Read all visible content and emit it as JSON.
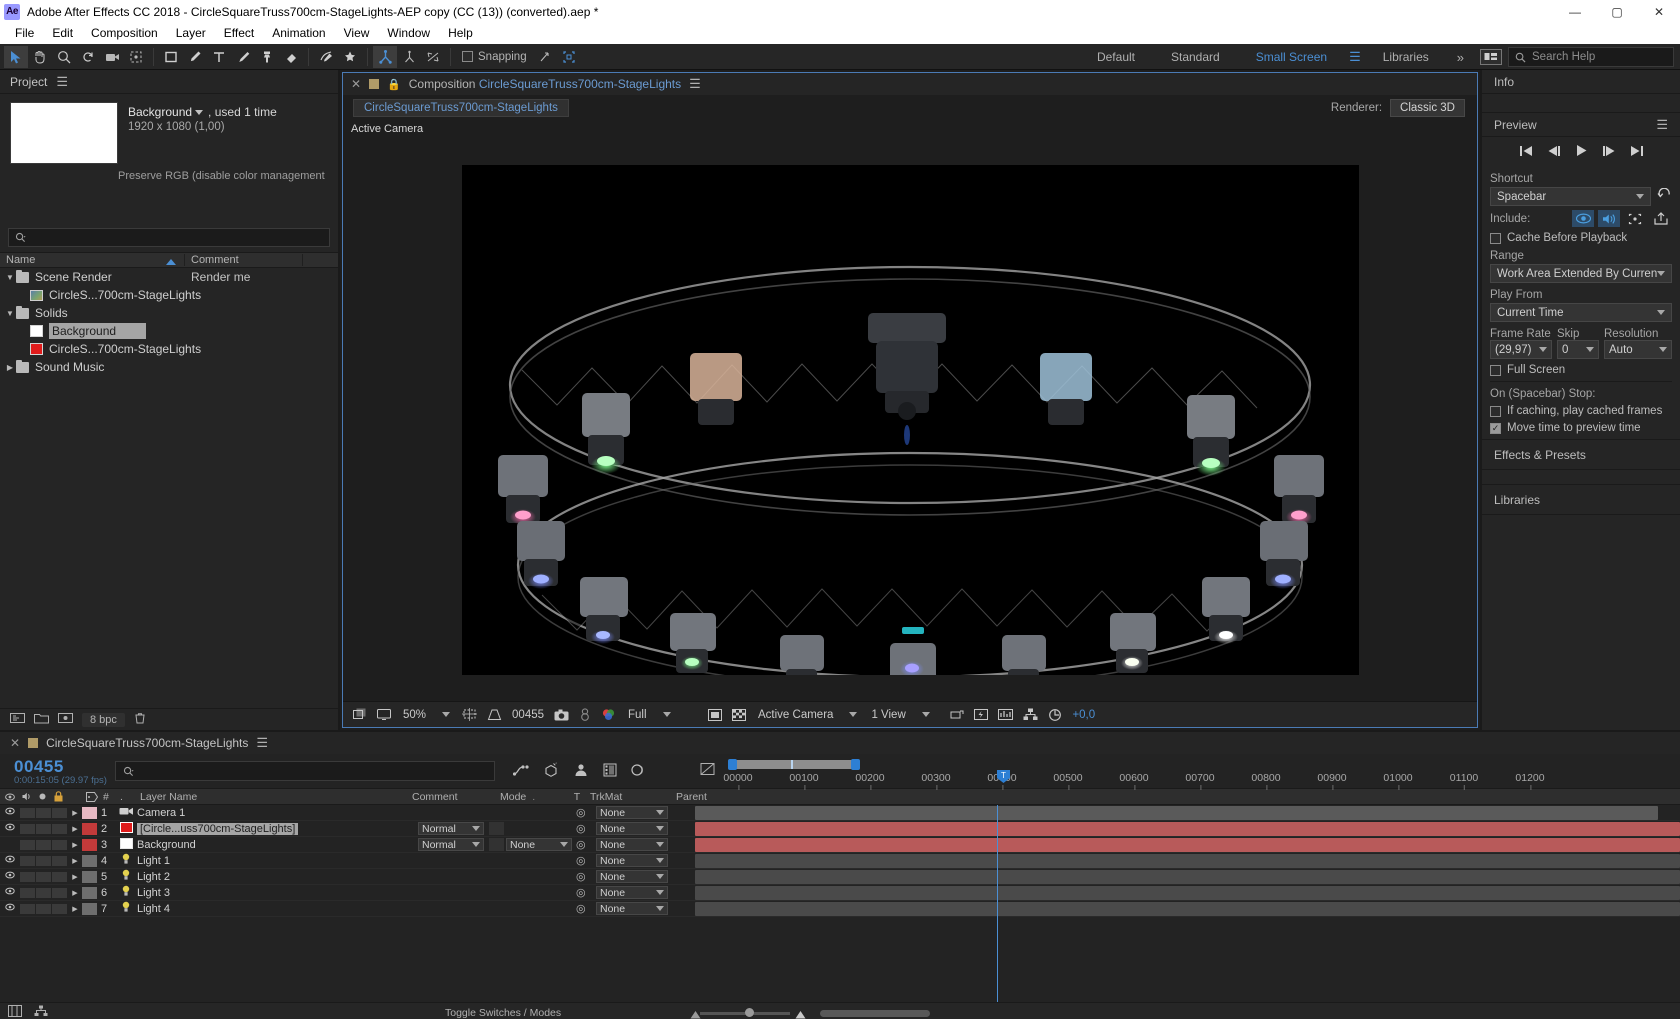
{
  "window": {
    "title": "Adobe After Effects CC 2018 - CircleSquareTruss700cm-StageLights-AEP copy (CC (13)) (converted).aep *",
    "logo": "Ae",
    "minimize": "—",
    "maximize": "▢",
    "close": "✕"
  },
  "menubar": [
    "File",
    "Edit",
    "Composition",
    "Layer",
    "Effect",
    "Animation",
    "View",
    "Window",
    "Help"
  ],
  "toolbar": {
    "snapping_label": "Snapping",
    "workspaces": [
      "Default",
      "Standard",
      "Small Screen"
    ],
    "selected_workspace": "Small Screen",
    "libraries_label": "Libraries",
    "chevrons": "»",
    "search_help_placeholder": "Search Help"
  },
  "project": {
    "tab_label": "Project",
    "item_name": "Background",
    "usage": ", used 1 time",
    "dimensions": "1920 x 1080 (1,00)",
    "color_note": "Preserve RGB (disable color management c...",
    "columns": [
      "Name",
      "Comment"
    ],
    "rows": [
      {
        "name": "Scene Render",
        "comment": "Render me",
        "type": "folder",
        "expanded": true,
        "indent": 0
      },
      {
        "name": "CircleS...700cm-StageLights",
        "comment": "",
        "type": "comp",
        "indent": 1
      },
      {
        "name": "Solids",
        "comment": "",
        "type": "folder",
        "expanded": true,
        "indent": 0
      },
      {
        "name": "Background",
        "comment": "",
        "type": "solid-white",
        "indent": 1,
        "selected": true
      },
      {
        "name": "CircleS...700cm-StageLights",
        "comment": "",
        "type": "solid-red",
        "indent": 1
      },
      {
        "name": "Sound Music",
        "comment": "",
        "type": "folder",
        "expanded": false,
        "indent": 0
      }
    ],
    "bpc_label": "8 bpc"
  },
  "composition": {
    "tab_prefix": "Composition",
    "tab_name": "CircleSquareTruss700cm-StageLights",
    "chip_label": "CircleSquareTruss700cm-StageLights",
    "renderer_label": "Renderer:",
    "renderer_value": "Classic 3D",
    "active_camera_label": "Active Camera",
    "bottom_bar": {
      "zoom": "50%",
      "timecode": "00455",
      "resolution": "Full",
      "camera_view": "Active Camera",
      "view_layout": "1 View",
      "exposure": "+0,0"
    }
  },
  "right_panel": {
    "info_label": "Info",
    "preview_label": "Preview",
    "shortcut_label": "Shortcut",
    "shortcut_value": "Spacebar",
    "include_label": "Include:",
    "cache_before_playback": "Cache Before Playback",
    "range_label": "Range",
    "range_value": "Work Area Extended By Current...",
    "play_from_label": "Play From",
    "play_from_value": "Current Time",
    "frame_rate_label": "Frame Rate",
    "frame_rate_value": "(29,97)",
    "skip_label": "Skip",
    "skip_value": "0",
    "resolution_label": "Resolution",
    "resolution_value": "Auto",
    "full_screen": "Full Screen",
    "on_stop_label": "On (Spacebar) Stop:",
    "if_caching": "If caching, play cached frames",
    "move_time": "Move time to preview time",
    "effects_presets_label": "Effects & Presets",
    "libraries_label": "Libraries"
  },
  "timeline": {
    "tab_name": "CircleSquareTruss700cm-StageLights",
    "current_frame": "00455",
    "current_time": "0:00:15:05 (29.97 fps)",
    "columns": [
      "Layer Name",
      "Comment",
      "Mode",
      "T",
      "TrkMat",
      "Parent"
    ],
    "ruler_labels": [
      "00000",
      "00100",
      "00200",
      "00300",
      "00400",
      "00500",
      "00600",
      "00700",
      "00800",
      "00900",
      "01000",
      "01100",
      "01200"
    ],
    "cti_label": "T",
    "toggle_switches_label": "Toggle Switches / Modes",
    "layers": [
      {
        "num": "1",
        "name": "Camera 1",
        "icon": "camera-icon",
        "mode": "",
        "trkmat": "",
        "parent": "None",
        "color": "#e7b9c3",
        "visible": true,
        "highlighted": false,
        "bar_color": "#5a5a5a"
      },
      {
        "num": "2",
        "name": "[Circle...uss700cm-StageLights]",
        "icon": "solid-red-icon",
        "mode": "Normal",
        "trkmat": "",
        "parent": "None",
        "color": "#c33a3a",
        "visible": true,
        "highlighted": true,
        "bar_color": "#b85a5a"
      },
      {
        "num": "3",
        "name": "Background",
        "icon": "solid-white-icon",
        "mode": "Normal",
        "trkmat": "None",
        "parent": "None",
        "color": "#c33a3a",
        "visible": false,
        "highlighted": false,
        "bar_color": "#b85a5a"
      },
      {
        "num": "4",
        "name": "Light 1",
        "icon": "light-icon",
        "mode": "",
        "trkmat": "",
        "parent": "None",
        "color": "#6e6e6e",
        "visible": true,
        "highlighted": false,
        "bar_color": "#4a4a4a"
      },
      {
        "num": "5",
        "name": "Light 2",
        "icon": "light-icon",
        "mode": "",
        "trkmat": "",
        "parent": "None",
        "color": "#6e6e6e",
        "visible": true,
        "highlighted": false,
        "bar_color": "#4a4a4a"
      },
      {
        "num": "6",
        "name": "Light 3",
        "icon": "light-icon",
        "mode": "",
        "trkmat": "",
        "parent": "None",
        "color": "#6e6e6e",
        "visible": true,
        "highlighted": false,
        "bar_color": "#4a4a4a"
      },
      {
        "num": "7",
        "name": "Light 4",
        "icon": "light-icon",
        "mode": "",
        "trkmat": "",
        "parent": "None",
        "color": "#6e6e6e",
        "visible": true,
        "highlighted": false,
        "bar_color": "#4a4a4a"
      }
    ]
  },
  "colors": {
    "accent_blue": "#4b8fd4",
    "panel_bg": "#252525",
    "app_bg": "#1e1e1e",
    "highlight": "#a5a5a5"
  }
}
